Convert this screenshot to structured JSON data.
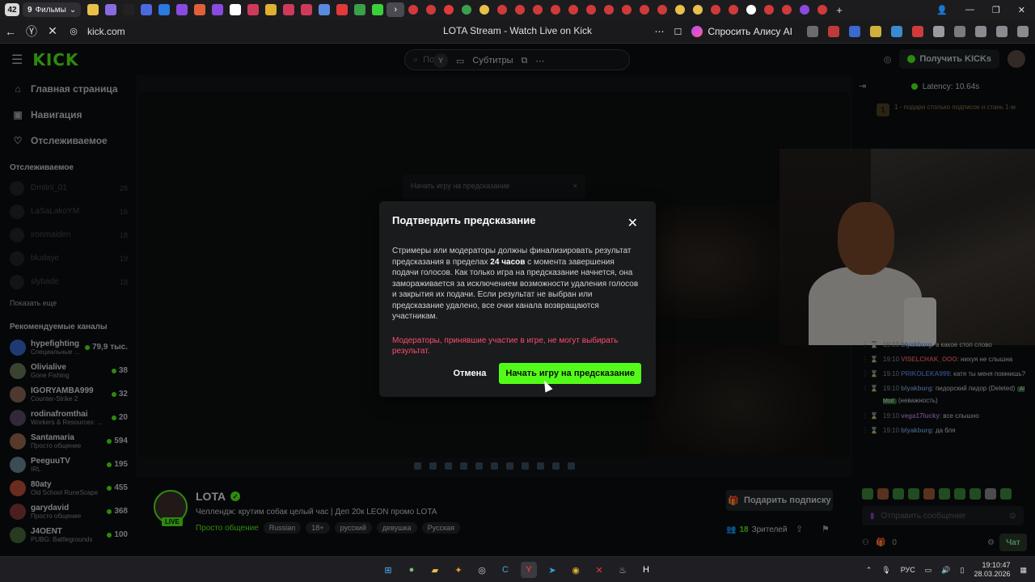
{
  "browser": {
    "tab_count": "42",
    "tab_group_count": "9",
    "tab_group_label": "Фильмы",
    "url": "kick.com",
    "page_title": "LOTA Stream - Watch Live on Kick",
    "alice_label": "Спросить Алису AI",
    "window_controls": [
      "—",
      "❐",
      "✕"
    ]
  },
  "kick": {
    "logo": "KICK",
    "search_placeholder": "Поиск",
    "get_kicks": "Получить KICKs",
    "nav": [
      {
        "label": "Главная страница",
        "icon": "home-icon"
      },
      {
        "label": "Навигация",
        "icon": "compass-icon"
      },
      {
        "label": "Отслеживаемое",
        "icon": "heart-icon"
      }
    ],
    "following_title": "Отслеживаемое",
    "following": [
      {
        "name": "Dmitrii_01",
        "count": "28"
      },
      {
        "name": "LaSaLakoYM",
        "count": "16"
      },
      {
        "name": "ironmaiden",
        "count": "18"
      },
      {
        "name": "bludaye",
        "count": "19"
      },
      {
        "name": "slybade",
        "count": "18"
      }
    ],
    "show_more": "Показать еще",
    "recommended_title": "Рекомендуемые каналы",
    "recommended": [
      {
        "name": "hypefighting",
        "category": "Специальные ...",
        "viewers": "79,9 тыс.",
        "color": "#3a6ad0"
      },
      {
        "name": "Olivialive",
        "category": "Gone Fishing",
        "viewers": "38",
        "color": "#6a7a5a"
      },
      {
        "name": "IGORYAMBA999",
        "category": "Counter-Strike 2",
        "viewers": "32",
        "color": "#8a6a5a"
      },
      {
        "name": "rodinafromthai",
        "category": "Workers & Resources: ...",
        "viewers": "20",
        "color": "#5a4a6a"
      },
      {
        "name": "Santamaria",
        "category": "Просто общение",
        "viewers": "594",
        "color": "#a06a50"
      },
      {
        "name": "PeeguuTV",
        "category": "IRL",
        "viewers": "195",
        "color": "#6a8a9a"
      },
      {
        "name": "80aty",
        "category": "Old School RuneScape",
        "viewers": "455",
        "color": "#c0503a"
      },
      {
        "name": "garydavid",
        "category": "Просто общение",
        "viewers": "368",
        "color": "#8a3a3a"
      },
      {
        "name": "J4OENT",
        "category": "PUBG: Battlegrounds",
        "viewers": "100",
        "color": "#4a6a3a"
      }
    ],
    "video_toolbar": {
      "subtitles": "Субтитры"
    },
    "stream": {
      "channel": "LOTA",
      "live": "LIVE",
      "title": "Челлендж: крутим собак целый час | Деп 20к LEON промо LOTA",
      "category": "Просто общение",
      "tags": [
        "Russian",
        "18+",
        "русский",
        "девушка",
        "Русская"
      ],
      "subscribe_gift": "Подарить подписку",
      "viewers": "18",
      "viewers_label": "Зрителей"
    },
    "chat": {
      "latency": "Latency: 10.64s",
      "pinned_num": "1",
      "pinned_text": "1 - подари столько подписок и стань 1-м",
      "messages": [
        {
          "time": "19:10",
          "user": "blyakburg",
          "user_color": "#6a9cd8",
          "text": ": а какое стоп слово"
        },
        {
          "time": "19:10",
          "user": "VISELCHAK_OOO",
          "user_color": "#e05a5a",
          "text": ": нихуя не слышна"
        },
        {
          "time": "19:10",
          "user": "PRIKOLEKA999",
          "user_color": "#5a7adf",
          "text": ": катя ты меня помнишь?"
        },
        {
          "time": "19:10",
          "user": "blyakburg",
          "user_color": "#6a9cd8",
          "text": ": пидорский пидор (Deleted)",
          "badge": "AI Mod",
          "extra": "(неважность)"
        },
        {
          "time": "19:10",
          "user": "vega17lucky",
          "user_color": "#b07ad8",
          "text": ": все слышно"
        },
        {
          "time": "19:10",
          "user": "blyakburg",
          "user_color": "#6a9cd8",
          "text": ": да бля"
        }
      ],
      "input_placeholder": "Отправить сообщение",
      "points": "0",
      "send": "Чат"
    }
  },
  "modal": {
    "title": "Подтвердить предсказание",
    "body_before": "Стримеры или модераторы должны финализировать результат предсказания в пределах ",
    "body_bold": "24 часов",
    "body_after": " с момента завершения подачи голосов. Как только игра на предсказание начнется, она замораживается за исключением возможности удаления голосов и закрытия их подачи. Если результат не выбран или предсказание удалено, все очки канала возвращаются участникам.",
    "warning": "Модераторы, принявшие участие в игре, не могут выбирать результат.",
    "cancel": "Отмена",
    "confirm": "Начать игру на предсказание"
  },
  "taskbar": {
    "lang": "РУС",
    "time": "19:10:47",
    "date": "28.03.2026"
  },
  "colors": {
    "kick_green": "#53fc18",
    "warning_red": "#ff4d6b"
  }
}
